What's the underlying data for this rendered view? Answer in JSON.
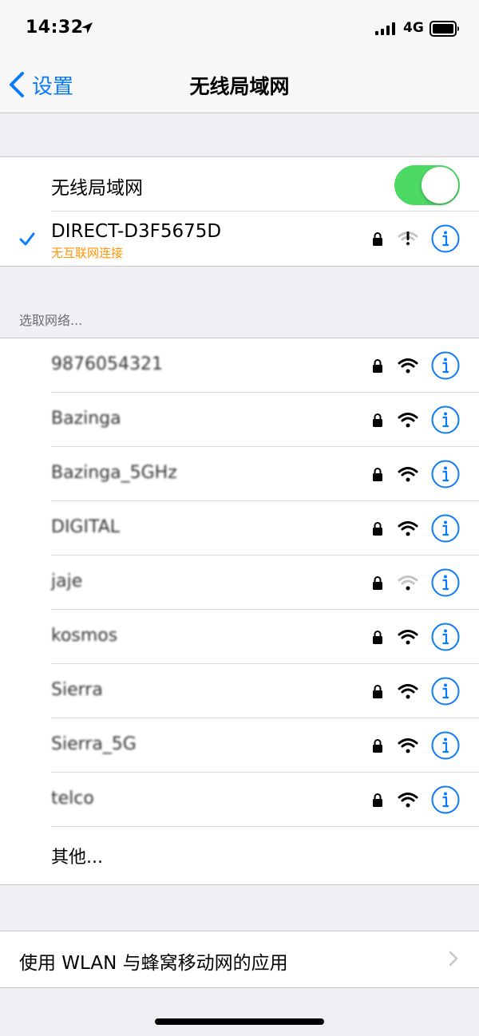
{
  "status_bar": {
    "time": "14:32",
    "network": "4G",
    "icons": [
      "location-arrow-icon",
      "cellular-signal-icon",
      "battery-icon"
    ]
  },
  "nav": {
    "back_label": "设置",
    "title": "无线局域网"
  },
  "wifi_toggle": {
    "label": "无线局域网",
    "on": true
  },
  "connected": {
    "name": "DIRECT-D3F5675D",
    "status": "无互联网连接",
    "status_color": "#ff9500"
  },
  "section_header": "选取网络...",
  "networks": [
    {
      "name": "9876054321"
    },
    {
      "name": "Bazinga"
    },
    {
      "name": "Bazinga_5GHz"
    },
    {
      "name": "DIGITAL"
    },
    {
      "name": "jaje"
    },
    {
      "name": "kosmos"
    },
    {
      "name": "Sierra"
    },
    {
      "name": "Sierra_5G"
    },
    {
      "name": "telco"
    }
  ],
  "other_label": "其他...",
  "apps_row": {
    "label": "使用 WLAN 与蜂窝移动网的应用"
  },
  "colors": {
    "accent": "#0a7aff",
    "toggle_on": "#4cd964",
    "background": "#efeff4",
    "warning": "#ff9500"
  }
}
